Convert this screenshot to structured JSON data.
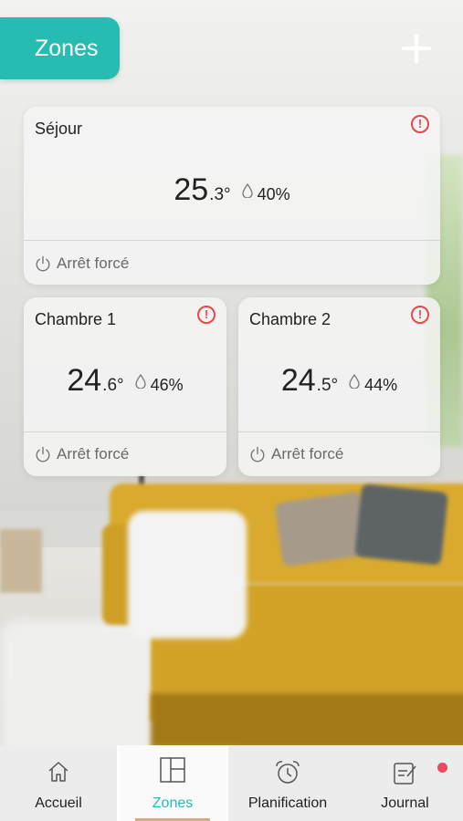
{
  "header": {
    "title": "Zones"
  },
  "zones": [
    {
      "name": "Séjour",
      "temp_int": "25",
      "temp_dec": ".3°",
      "humidity": "40%",
      "mode": "Arrêt forcé"
    },
    {
      "name": "Chambre 1",
      "temp_int": "24",
      "temp_dec": ".6°",
      "humidity": "46%",
      "mode": "Arrêt forcé"
    },
    {
      "name": "Chambre 2",
      "temp_int": "24",
      "temp_dec": ".5°",
      "humidity": "44%",
      "mode": "Arrêt forcé"
    }
  ],
  "nav": {
    "items": [
      {
        "label": "Accueil",
        "icon": "home-icon"
      },
      {
        "label": "Zones",
        "icon": "zones-grid-icon",
        "active": true
      },
      {
        "label": "Planification",
        "icon": "alarm-clock-icon"
      },
      {
        "label": "Journal",
        "icon": "journal-icon",
        "badge": true
      }
    ]
  },
  "colors": {
    "accent": "#26bcb1",
    "alert": "#e5484d",
    "badge": "#e9495d"
  }
}
